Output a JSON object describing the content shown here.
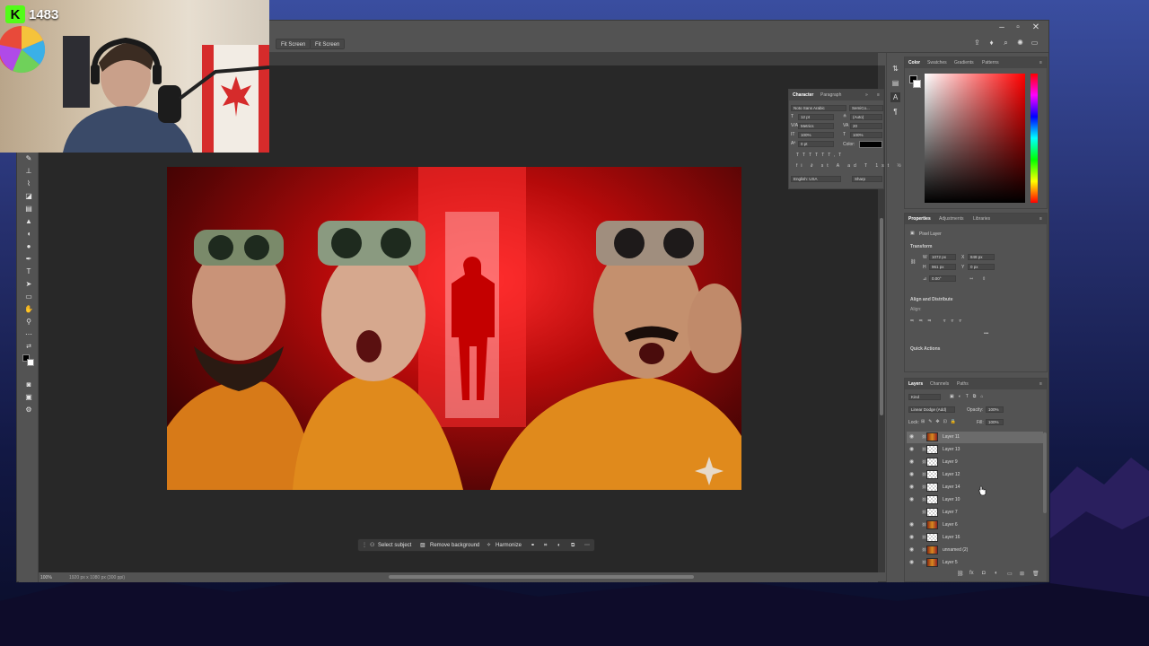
{
  "overlay": {
    "viewer_icon": "kick-logo-icon",
    "viewer_count": "1483"
  },
  "options_bar": {
    "fit_screen_1": "Fit Screen",
    "fit_screen_2": "Fit Screen"
  },
  "status_bar": {
    "zoom": "100%",
    "doc_info": "1920 px x 1080 px (300 ppi)"
  },
  "context_taskbar": {
    "select_subject": "Select subject",
    "remove_background": "Remove background",
    "harmonize": "Harmonize"
  },
  "character_panel": {
    "tabs": [
      "Character",
      "Paragraph"
    ],
    "font_family": "Noto Sans Arabic",
    "font_style": "SemiCo...",
    "font_size": "12 pt",
    "leading": "(Auto)",
    "kerning": "Metrics",
    "tracking": "20",
    "vert_scale": "100%",
    "horiz_scale": "100%",
    "baseline": "0 pt",
    "color_label": "Color:",
    "language": "English: USA",
    "antialias": "Sharp"
  },
  "color_panel": {
    "tabs": [
      "Color",
      "Swatches",
      "Gradients",
      "Patterns"
    ],
    "accent": "#ff0000"
  },
  "properties_panel": {
    "tabs": [
      "Properties",
      "Adjustments",
      "Libraries"
    ],
    "layer_type": "Pixel Layer",
    "transform_title": "Transform",
    "w_label": "W",
    "w_value": "1072 px",
    "h_label": "H",
    "h_value": "961 px",
    "x_label": "X",
    "x_value": "848 px",
    "y_label": "Y",
    "y_value": "0 px",
    "angle": "0.00°",
    "align_title": "Align and Distribute",
    "align_label": "Align:",
    "more": "•••",
    "quick_actions": "Quick Actions"
  },
  "layers_panel": {
    "tabs": [
      "Layers",
      "Channels",
      "Paths"
    ],
    "filter_kind": "Kind",
    "blend_mode": "Linear Dodge (Add)",
    "opacity_label": "Opacity:",
    "opacity_value": "100%",
    "lock_label": "Lock:",
    "fill_label": "Fill:",
    "fill_value": "100%",
    "layers": [
      {
        "name": "Layer 11",
        "visible": true,
        "selected": true,
        "thumb": "img"
      },
      {
        "name": "Layer 13",
        "visible": true,
        "selected": false,
        "thumb": "checker"
      },
      {
        "name": "Layer 9",
        "visible": true,
        "selected": false,
        "thumb": "checker"
      },
      {
        "name": "Layer 12",
        "visible": true,
        "selected": false,
        "thumb": "checker"
      },
      {
        "name": "Layer 14",
        "visible": true,
        "selected": false,
        "thumb": "checker"
      },
      {
        "name": "Layer 10",
        "visible": true,
        "selected": false,
        "thumb": "checker"
      },
      {
        "name": "Layer 7",
        "visible": false,
        "selected": false,
        "thumb": "checker"
      },
      {
        "name": "Layer 6",
        "visible": true,
        "selected": false,
        "thumb": "img"
      },
      {
        "name": "Layer 16",
        "visible": true,
        "selected": false,
        "thumb": "checker"
      },
      {
        "name": "unnamed (2)",
        "visible": true,
        "selected": false,
        "thumb": "img"
      },
      {
        "name": "Layer 5",
        "visible": true,
        "selected": false,
        "thumb": "img"
      }
    ]
  }
}
